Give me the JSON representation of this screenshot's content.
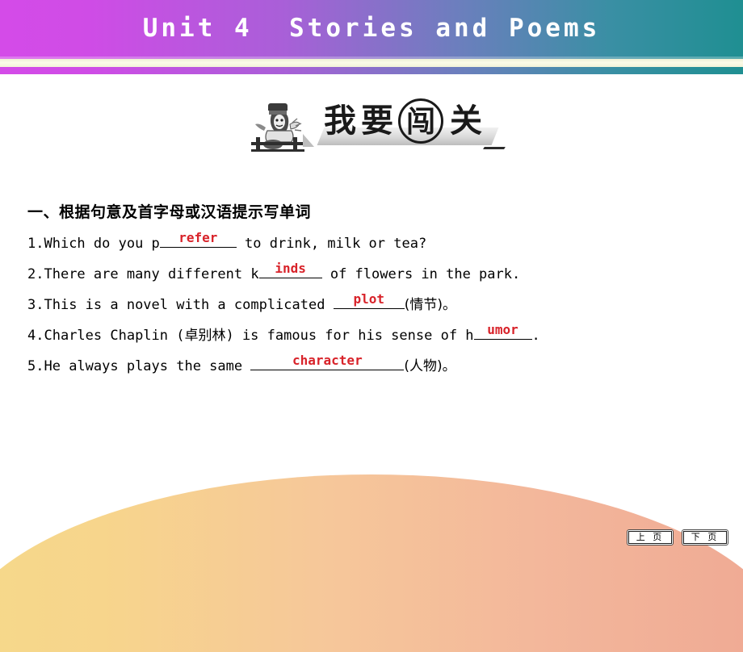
{
  "header": {
    "title": "Unit 4  Stories and Poems",
    "gradient_left": "#d44be8",
    "gradient_right": "#1f8f92",
    "stripe_color": "#fbfbe8"
  },
  "logo": {
    "mascot_icon": "student-climbing-icon",
    "chars": [
      "我",
      "要",
      "闯",
      "关"
    ],
    "circled_index": 2,
    "full_text": "我要闯关"
  },
  "content": {
    "section_heading": "一、根据句意及首字母或汉语提示写单词",
    "answer_color": "#d8232a",
    "questions": [
      {
        "num": "1.",
        "before": "Which do you p",
        "answer": "refer",
        "after": " to drink, milk or tea?",
        "chinese": ""
      },
      {
        "num": "2.",
        "before": "There are many different k",
        "answer": "inds",
        "after": " of flowers in the park.",
        "chinese": ""
      },
      {
        "num": "3.",
        "before": "This is a novel with a complicated ",
        "answer": "plot",
        "after": "",
        "chinese": "(情节)。"
      },
      {
        "num": "4.",
        "before": "Charles Chaplin (卓别林) is famous for his sense of h",
        "answer": "umor",
        "after": ".",
        "chinese": ""
      },
      {
        "num": "5.",
        "before": "He always plays the same ",
        "answer": "character",
        "after": "",
        "chinese": "(人物)。"
      }
    ]
  },
  "footer": {
    "prev_label": "上 页",
    "next_label": "下 页",
    "decor_gradient_left": "#f5d98a",
    "decor_gradient_right": "#efa893"
  }
}
